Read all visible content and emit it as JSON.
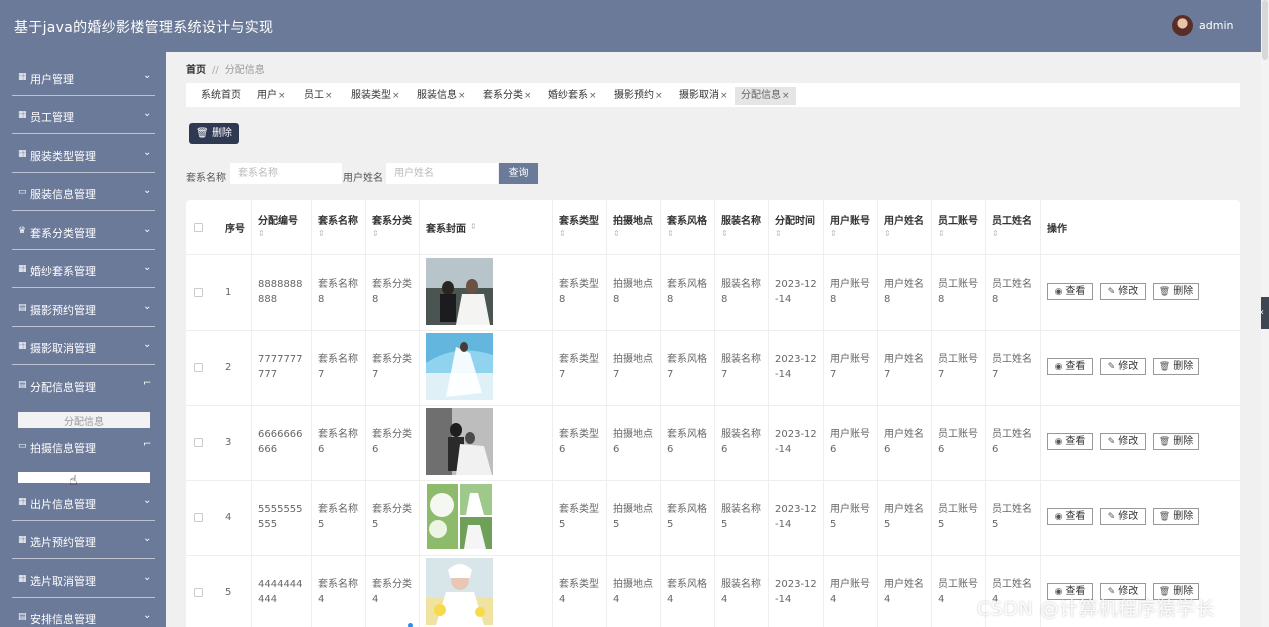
{
  "app": {
    "title": "基于java的婚纱影楼管理系统设计与实现",
    "user": "admin"
  },
  "sidebar": {
    "items": [
      {
        "label": "用户管理",
        "icon": "grid-icon",
        "arrow": "chevron-down"
      },
      {
        "label": "员工管理",
        "icon": "grid-icon",
        "arrow": "chevron-down"
      },
      {
        "label": "服装类型管理",
        "icon": "grid-icon",
        "arrow": "chevron-down"
      },
      {
        "label": "服装信息管理",
        "icon": "monitor-icon",
        "arrow": "chevron-down"
      },
      {
        "label": "套系分类管理",
        "icon": "trophy-icon",
        "arrow": "chevron-down"
      },
      {
        "label": "婚纱套系管理",
        "icon": "grid-icon",
        "arrow": "chevron-down"
      },
      {
        "label": "摄影预约管理",
        "icon": "clipboard-icon",
        "arrow": "chevron-down"
      },
      {
        "label": "摄影取消管理",
        "icon": "grid-icon",
        "arrow": "chevron-down"
      },
      {
        "label": "分配信息管理",
        "icon": "clipboard-icon",
        "arrow": "chevron-up"
      },
      {
        "label": "拍摄信息管理",
        "icon": "monitor-icon",
        "arrow": "chevron-up"
      },
      {
        "label": "出片信息管理",
        "icon": "grid-icon",
        "arrow": "chevron-down"
      },
      {
        "label": "选片预约管理",
        "icon": "grid-icon",
        "arrow": "chevron-down"
      },
      {
        "label": "选片取消管理",
        "icon": "grid-icon",
        "arrow": "chevron-down"
      },
      {
        "label": "安排信息管理",
        "icon": "clipboard-icon",
        "arrow": "chevron-down"
      }
    ],
    "submenu_label": "分配信息"
  },
  "breadcrumb": {
    "home": "首页",
    "separator": "//",
    "current": "分配信息"
  },
  "tabs": [
    {
      "label": "系统首页",
      "closable": false
    },
    {
      "label": "用户",
      "closable": true
    },
    {
      "label": "员工",
      "closable": true
    },
    {
      "label": "服装类型",
      "closable": true
    },
    {
      "label": "服装信息",
      "closable": true
    },
    {
      "label": "套系分类",
      "closable": true
    },
    {
      "label": "婚纱套系",
      "closable": true
    },
    {
      "label": "摄影预约",
      "closable": true
    },
    {
      "label": "摄影取消",
      "closable": true
    },
    {
      "label": "分配信息",
      "closable": true,
      "active": true
    }
  ],
  "tab_close": "×",
  "toolbar": {
    "delete_label": "删除"
  },
  "search": {
    "name_label": "套系名称",
    "name_placeholder": "套系名称",
    "user_label": "用户姓名",
    "user_placeholder": "用户姓名",
    "button": "查询"
  },
  "table": {
    "headers": [
      "序号",
      "分配编号",
      "套系名称",
      "套系分类",
      "套系封面",
      "套系类型",
      "拍摄地点",
      "套系风格",
      "服装名称",
      "分配时间",
      "用户账号",
      "用户姓名",
      "员工账号",
      "员工姓名",
      "操作"
    ],
    "sortable": [
      false,
      true,
      true,
      true,
      true,
      true,
      true,
      true,
      true,
      true,
      true,
      true,
      true,
      true,
      false
    ],
    "actions": {
      "view": "查看",
      "edit": "修改",
      "delete": "删除"
    },
    "rows": [
      {
        "index": "1",
        "code": "8888888888",
        "name": "套系名称8",
        "category": "套系分类8",
        "type": "套系类型8",
        "location": "拍摄地点8",
        "style": "套系风格8",
        "clothing": "服装名称8",
        "time": "2023-12-14",
        "user_account": "用户账号8",
        "user_name": "用户姓名8",
        "staff_account": "员工账号8",
        "staff_name": "员工姓名8",
        "cover": "photo-couple-beach"
      },
      {
        "index": "2",
        "code": "7777777777",
        "name": "套系名称7",
        "category": "套系分类7",
        "type": "套系类型7",
        "location": "拍摄地点7",
        "style": "套系风格7",
        "clothing": "服装名称7",
        "time": "2023-12-14",
        "user_account": "用户账号7",
        "user_name": "用户姓名7",
        "staff_account": "员工账号7",
        "staff_name": "员工姓名7",
        "cover": "photo-bride-sea"
      },
      {
        "index": "3",
        "code": "6666666666",
        "name": "套系名称6",
        "category": "套系分类6",
        "type": "套系类型6",
        "location": "拍摄地点6",
        "style": "套系风格6",
        "clothing": "服装名称6",
        "time": "2023-12-14",
        "user_account": "用户账号6",
        "user_name": "用户姓名6",
        "staff_account": "员工账号6",
        "staff_name": "员工姓名6",
        "cover": "photo-couple-bw"
      },
      {
        "index": "4",
        "code": "5555555555",
        "name": "套系名称5",
        "category": "套系分类5",
        "type": "套系类型5",
        "location": "拍摄地点5",
        "style": "套系风格5",
        "clothing": "服装名称5",
        "time": "2023-12-14",
        "user_account": "用户账号5",
        "user_name": "用户姓名5",
        "staff_account": "员工账号5",
        "staff_name": "员工姓名5",
        "cover": "photo-collage-green"
      },
      {
        "index": "5",
        "code": "4444444444",
        "name": "套系名称4",
        "category": "套系分类4",
        "type": "套系类型4",
        "location": "拍摄地点4",
        "style": "套系风格4",
        "clothing": "服装名称4",
        "time": "2023-12-14",
        "user_account": "用户账号4",
        "user_name": "用户姓名4",
        "staff_account": "员工账号4",
        "staff_name": "员工姓名4",
        "cover": "photo-bride-flowers"
      }
    ]
  },
  "watermark": "CSDN @计算机程序猿学长",
  "colors": {
    "topbar": "#6b7a99",
    "sidebar": "#6b7a99",
    "primary_button": "#2f3a52",
    "search_button": "#6b7a99"
  }
}
